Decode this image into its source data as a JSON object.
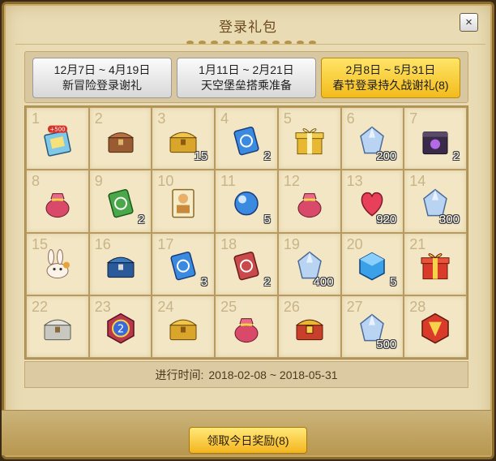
{
  "window": {
    "title": "登录礼包"
  },
  "close_label": "×",
  "tabs": [
    {
      "date": "12月7日 ~ 4月19日",
      "name": "新冒险登录谢礼",
      "active": false
    },
    {
      "date": "1月11日 ~ 2月21日",
      "name": "天空堡垒搭乘准备",
      "active": false
    },
    {
      "date": "2月8日 ~ 5月31日",
      "name": "春节登录持久战谢礼(8)",
      "active": true
    }
  ],
  "rewards": [
    {
      "day": "1",
      "icon": "ticket-card-icon",
      "count": ""
    },
    {
      "day": "2",
      "icon": "brown-chest-icon",
      "count": ""
    },
    {
      "day": "3",
      "icon": "gold-chest-icon",
      "count": "15"
    },
    {
      "day": "4",
      "icon": "blue-card-icon",
      "count": "2"
    },
    {
      "day": "5",
      "icon": "gift-box-icon",
      "count": ""
    },
    {
      "day": "6",
      "icon": "crystal-icon",
      "count": "200"
    },
    {
      "day": "7",
      "icon": "dark-box-icon",
      "count": "2"
    },
    {
      "day": "8",
      "icon": "red-pouch-icon",
      "count": ""
    },
    {
      "day": "9",
      "icon": "green-card-icon",
      "count": "2"
    },
    {
      "day": "10",
      "icon": "character-card-icon",
      "count": ""
    },
    {
      "day": "11",
      "icon": "blue-orb-icon",
      "count": "5"
    },
    {
      "day": "12",
      "icon": "red-pouch-icon",
      "count": ""
    },
    {
      "day": "13",
      "icon": "heart-icon",
      "count": "920"
    },
    {
      "day": "14",
      "icon": "crystal-icon",
      "count": "300"
    },
    {
      "day": "15",
      "icon": "rabbit-pet-icon",
      "count": ""
    },
    {
      "day": "16",
      "icon": "blue-chest-icon",
      "count": ""
    },
    {
      "day": "17",
      "icon": "blue-card-icon",
      "count": "3"
    },
    {
      "day": "18",
      "icon": "red-card-icon",
      "count": "2"
    },
    {
      "day": "19",
      "icon": "crystal-icon",
      "count": "400"
    },
    {
      "day": "20",
      "icon": "blue-block-icon",
      "count": "5"
    },
    {
      "day": "21",
      "icon": "red-gift-icon",
      "count": ""
    },
    {
      "day": "22",
      "icon": "silver-chest-icon",
      "count": ""
    },
    {
      "day": "23",
      "icon": "medal-2-icon",
      "count": ""
    },
    {
      "day": "24",
      "icon": "gold-chest-icon",
      "count": ""
    },
    {
      "day": "25",
      "icon": "red-pouch-icon",
      "count": ""
    },
    {
      "day": "26",
      "icon": "ornate-chest-icon",
      "count": ""
    },
    {
      "day": "27",
      "icon": "crystal-icon",
      "count": "500"
    },
    {
      "day": "28",
      "icon": "red-emblem-icon",
      "count": ""
    }
  ],
  "period": {
    "label": "进行时间:",
    "range": "2018-02-08 ~ 2018-05-31"
  },
  "claim_button": "领取今日奖励(8)",
  "colors": {
    "accent_gold": "#f4b51e",
    "parchment": "#e9dcb4",
    "frame": "#8b6a30"
  }
}
